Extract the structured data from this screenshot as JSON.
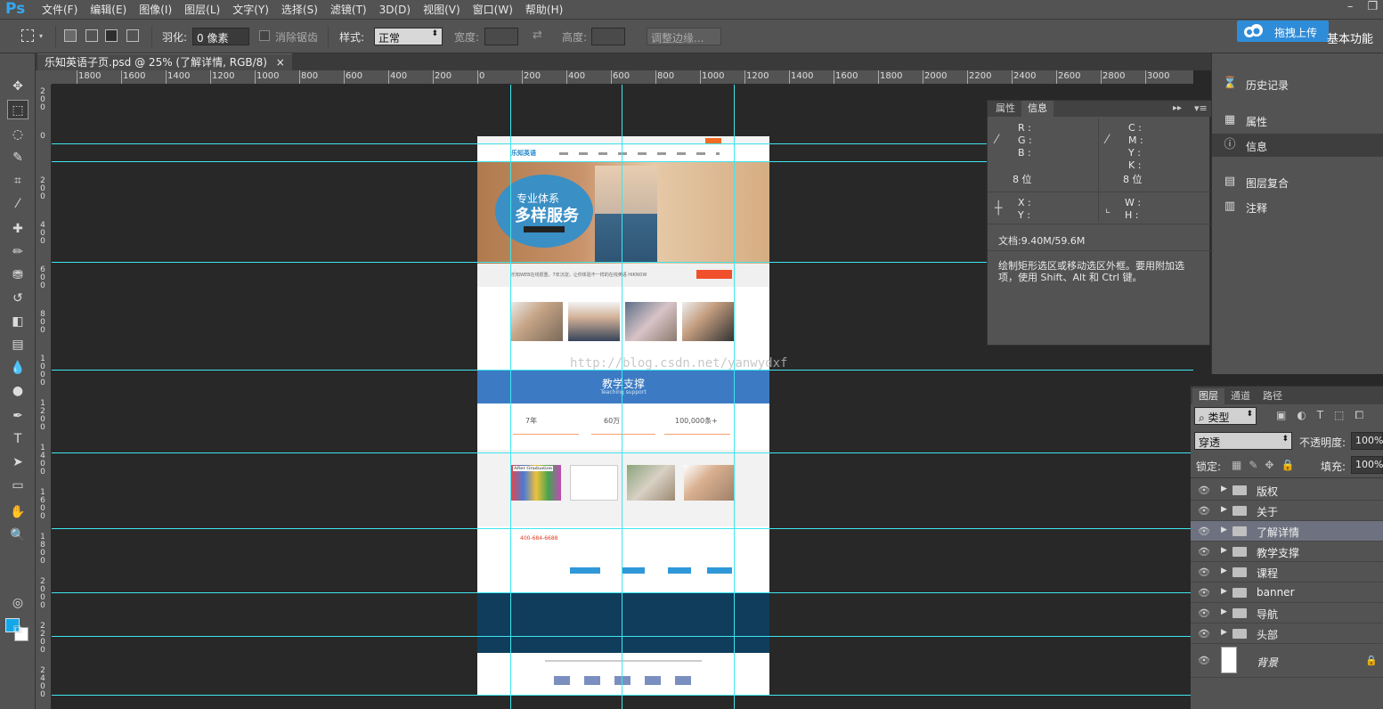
{
  "app": {
    "logo": "Ps"
  },
  "menu": [
    "文件(F)",
    "编辑(E)",
    "图像(I)",
    "图层(L)",
    "文字(Y)",
    "选择(S)",
    "滤镜(T)",
    "3D(D)",
    "视图(V)",
    "窗口(W)",
    "帮助(H)"
  ],
  "options": {
    "feather_label": "羽化:",
    "feather_value": "0 像素",
    "antialias_label": "消除锯齿",
    "style_label": "样式:",
    "style_value": "正常",
    "width_label": "宽度:",
    "height_label": "高度:",
    "refine_button": "调整边缘..."
  },
  "upload_button": "拖拽上传",
  "workspace_label": "基本功能",
  "document_tab": "乐知英语子页.psd @ 25% (了解详情, RGB/8)",
  "document_tab_close": "×",
  "ruler_h": [
    "1800",
    "1600",
    "1400",
    "1200",
    "1000",
    "800",
    "600",
    "400",
    "200",
    "0",
    "200",
    "400",
    "600",
    "800",
    "1000",
    "1200",
    "1400",
    "1600",
    "1800",
    "2000",
    "2200",
    "2400",
    "2600",
    "2800",
    "3000"
  ],
  "ruler_v": [
    "200",
    "0",
    "200",
    "400",
    "600",
    "800",
    "1000",
    "1200",
    "1400",
    "1600",
    "1800",
    "2000",
    "2200",
    "2400"
  ],
  "info_panel": {
    "tab_properties": "属性",
    "tab_info": "信息",
    "r": "R :",
    "g": "G :",
    "b": "B :",
    "bits_left": "8 位",
    "c": "C :",
    "m": "M :",
    "y": "Y :",
    "k": "K :",
    "bits_right": "8 位",
    "x": "X :",
    "y2": "Y :",
    "w": "W :",
    "h": "H :",
    "doc": "文档:9.40M/59.6M",
    "hint": "绘制矩形选区或移动选区外框。要用附加选项，使用 Shift、Alt 和 Ctrl 键。"
  },
  "side_panels": [
    "历史记录",
    "属性",
    "信息",
    "图层复合",
    "注释"
  ],
  "layers_panel": {
    "tabs": [
      "图层",
      "通道",
      "路径"
    ],
    "filter_label": "类型",
    "blend_mode": "穿透",
    "opacity_label": "不透明度:",
    "opacity_value": "100%",
    "lock_label": "锁定:",
    "fill_label": "填充:",
    "fill_value": "100%",
    "layers": [
      "版权",
      "关于",
      "了解详情",
      "教学支撑",
      "课程",
      "banner",
      "导航",
      "头部"
    ],
    "background": "背景",
    "selected": "了解详情"
  },
  "watermark": "http://blog.csdn.net/yanwydxf",
  "page_preview": {
    "logo": "乐知英语",
    "banner_line1": "专业体系",
    "banner_line2": "多样服务",
    "intro_text": "乐知WEB在线很重，7年沉淀，让你体验不一样的在线英语 HIKNOW",
    "support_title": "教学支撑",
    "support_subtitle": "Teaching support",
    "stat1": "7年",
    "stat2": "60万",
    "stat3": "100,000条+",
    "after_grad": "After Graduation",
    "phone": "400-684-6688"
  },
  "colors": {
    "accent": "#12a7e8",
    "guide": "#3ee6ef",
    "panel": "#535353"
  }
}
